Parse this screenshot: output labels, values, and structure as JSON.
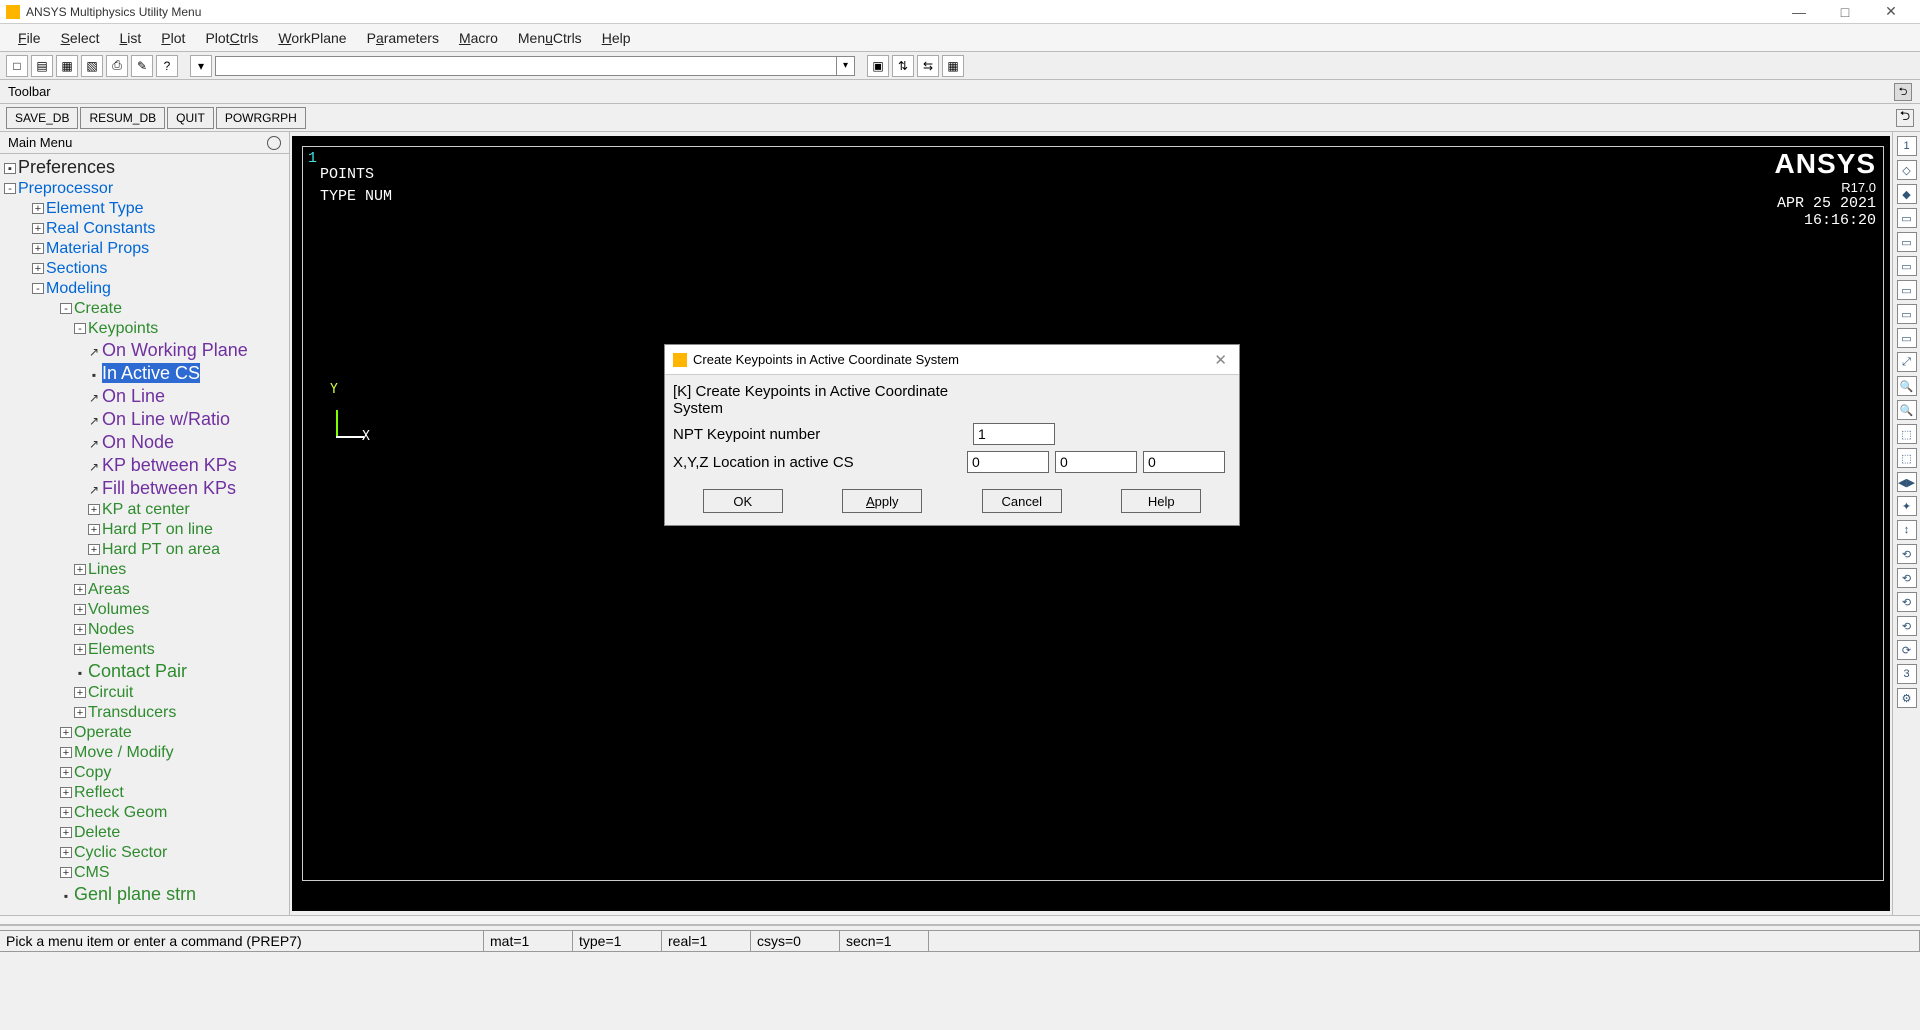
{
  "window": {
    "title": "ANSYS Multiphysics Utility Menu",
    "min": "—",
    "max": "□",
    "close": "✕"
  },
  "menubar": [
    "File",
    "Select",
    "List",
    "Plot",
    "PlotCtrls",
    "WorkPlane",
    "Parameters",
    "Macro",
    "MenuCtrls",
    "Help"
  ],
  "menubar_ul": [
    "F",
    "S",
    "L",
    "P",
    "C",
    "W",
    "a",
    "M",
    "u",
    "H"
  ],
  "toolbar_icons": [
    "□",
    "▤",
    "▦",
    "▧",
    "⎙",
    "✎",
    "?"
  ],
  "toolbar_icons2": [
    "▣",
    "⇅",
    "⇆",
    "▦"
  ],
  "toolbar_label": "Toolbar",
  "quickbar": [
    "SAVE_DB",
    "RESUM_DB",
    "QUIT",
    "POWRGRPH"
  ],
  "mainmenu_label": "Main Menu",
  "tree": {
    "preferences": "Preferences",
    "preprocessor": "Preprocessor",
    "element_type": "Element Type",
    "real_constants": "Real Constants",
    "material_props": "Material Props",
    "sections": "Sections",
    "modeling": "Modeling",
    "create": "Create",
    "keypoints": "Keypoints",
    "on_working_plane": "On Working Plane",
    "in_active_cs": "In Active CS",
    "on_line": "On Line",
    "on_line_w_ratio": "On Line w/Ratio",
    "on_node": "On Node",
    "kp_between_kps": "KP between KPs",
    "fill_between_kps": "Fill between KPs",
    "kp_at_center": "KP at center",
    "hard_pt_on_line": "Hard PT on line",
    "hard_pt_on_area": "Hard PT on area",
    "lines": "Lines",
    "areas": "Areas",
    "volumes": "Volumes",
    "nodes": "Nodes",
    "elements": "Elements",
    "contact_pair": "Contact Pair",
    "circuit": "Circuit",
    "transducers": "Transducers",
    "operate": "Operate",
    "move_modify": "Move / Modify",
    "copy": "Copy",
    "reflect": "Reflect",
    "check_geom": "Check Geom",
    "delete": "Delete",
    "cyclic_sector": "Cyclic Sector",
    "cms": "CMS",
    "genl_plane_strn": "Genl plane strn"
  },
  "gfx": {
    "one": "1",
    "points": "POINTS",
    "typenum": "TYPE NUM",
    "brand": "ANSYS",
    "version": "R17.0",
    "date": "APR 25 2021",
    "time": "16:16:20",
    "x": "X",
    "y": "Y"
  },
  "rightstrip_count": 24,
  "rightstrip_top": "1",
  "rightstrip_bottom": "3",
  "dialog": {
    "title": "Create Keypoints in Active Coordinate System",
    "header": "[K]  Create Keypoints in Active Coordinate System",
    "row1_label": "NPT   Keypoint number",
    "row1_value": "1",
    "row2_label": "X,Y,Z Location in active CS",
    "row2_x": "0",
    "row2_y": "0",
    "row2_z": "0",
    "ok": "OK",
    "apply": "Apply",
    "cancel": "Cancel",
    "help": "Help",
    "close": "✕"
  },
  "status": {
    "prompt": "Pick a menu item or enter a command (PREP7)",
    "mat": "mat=1",
    "type": "type=1",
    "real": "real=1",
    "csys": "csys=0",
    "secn": "secn=1"
  }
}
